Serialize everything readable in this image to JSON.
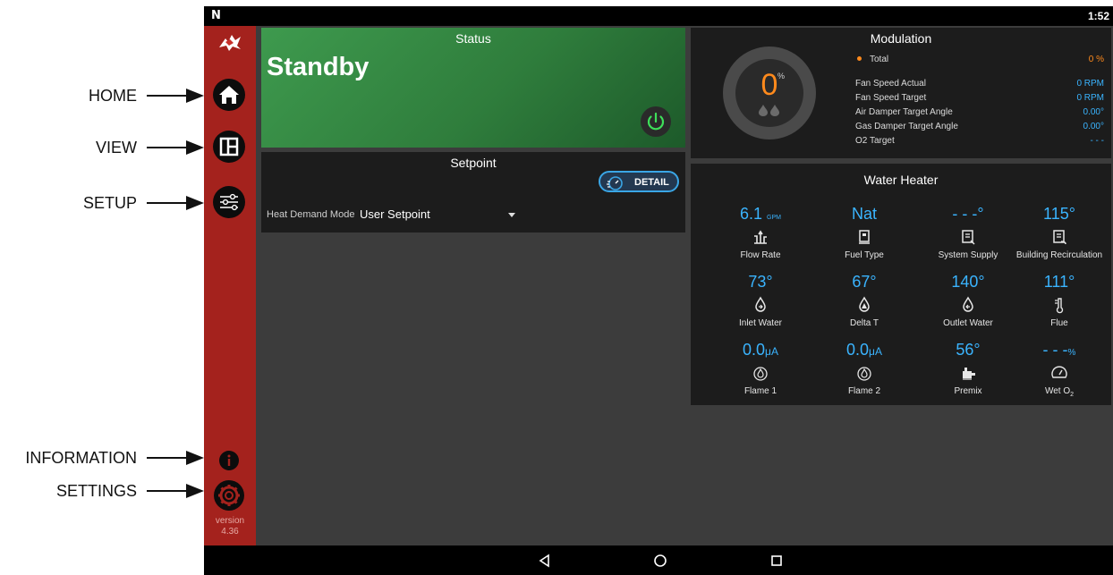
{
  "callouts": {
    "home": "HOME",
    "view": "VIEW",
    "setup": "SETUP",
    "information": "INFORMATION",
    "settings": "SETTINGS"
  },
  "statusbar": {
    "time": "1:52"
  },
  "sidebar": {
    "version_label": "version",
    "version_number": "4.36",
    "icons": [
      "home-icon",
      "view-layout-icon",
      "setup-sliders-icon",
      "info-icon",
      "settings-gear-icon"
    ],
    "accent": "#a4221d"
  },
  "status": {
    "title": "Status",
    "value": "Standby",
    "accent": "#3e9a4e"
  },
  "setpoint": {
    "title": "Setpoint",
    "detail_button": "DETAIL",
    "heat_demand_label": "Heat Demand Mode",
    "heat_demand_value": "User Setpoint"
  },
  "modulation": {
    "title": "Modulation",
    "gauge_value": "0",
    "gauge_unit": "%",
    "rows": [
      {
        "label": "Total",
        "value": "0 %"
      },
      {
        "label": "Fan Speed Actual",
        "value": "0 RPM"
      },
      {
        "label": "Fan Speed Target",
        "value": "0 RPM"
      },
      {
        "label": "Air Damper Target Angle",
        "value": "0.00°"
      },
      {
        "label": "Gas Damper Target Angle",
        "value": "0.00°"
      },
      {
        "label": "O2 Target",
        "value": "- - -"
      }
    ],
    "value_color": "#3ab4ff",
    "total_color": "#ff8a1c"
  },
  "water_heater": {
    "title": "Water Heater",
    "cells": [
      {
        "value": "6.1",
        "unit": "GPM",
        "label": "Flow Rate",
        "icon": "flow-icon"
      },
      {
        "value": "Nat",
        "unit": "",
        "label": "Fuel Type",
        "icon": "fuel-meter-icon"
      },
      {
        "value": "- - -°",
        "unit": "",
        "label": "System Supply",
        "icon": "system-supply-icon"
      },
      {
        "value": "115°",
        "unit": "",
        "label": "Building Recirculation",
        "icon": "building-recirculation-icon"
      },
      {
        "value": "73°",
        "unit": "",
        "label": "Inlet Water",
        "icon": "inlet-drop-icon"
      },
      {
        "value": "67°",
        "unit": "",
        "label": "Delta T",
        "icon": "delta-drop-icon"
      },
      {
        "value": "140°",
        "unit": "",
        "label": "Outlet Water",
        "icon": "outlet-drop-icon"
      },
      {
        "value": "111°",
        "unit": "",
        "label": "Flue",
        "icon": "flue-thermometer-icon"
      },
      {
        "value": "0.0",
        "unit": "μA",
        "label": "Flame 1",
        "icon": "flame-icon"
      },
      {
        "value": "0.0",
        "unit": "μA",
        "label": "Flame 2",
        "icon": "flame-icon"
      },
      {
        "value": "56°",
        "unit": "",
        "label": "Premix",
        "icon": "premix-icon"
      },
      {
        "value": "- - -",
        "unit": "%",
        "label": "Wet O",
        "label_sub": "2",
        "icon": "gauge-dial-icon"
      }
    ]
  }
}
